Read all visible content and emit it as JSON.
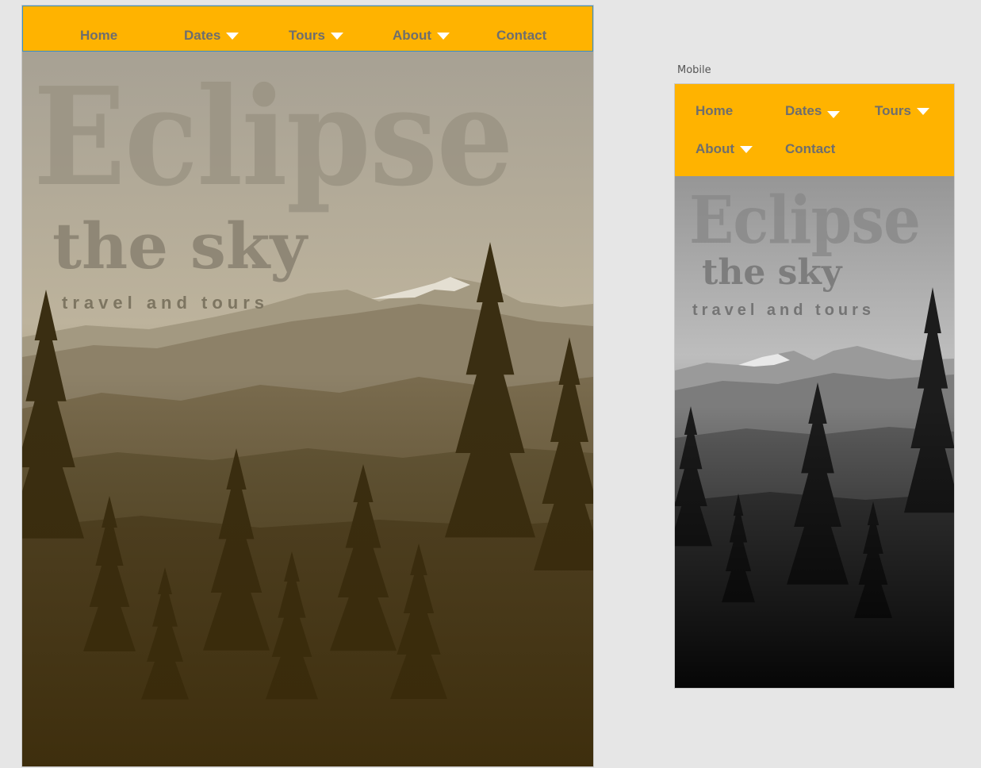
{
  "artboards": {
    "mobile_label": "Mobile"
  },
  "nav": {
    "items": [
      {
        "label": "Home",
        "dropdown": false
      },
      {
        "label": "Dates",
        "dropdown": true
      },
      {
        "label": "Tours",
        "dropdown": true
      },
      {
        "label": "About",
        "dropdown": true
      },
      {
        "label": "Contact",
        "dropdown": false
      }
    ],
    "background": "#FFB300",
    "text_color": "#6E6E6E",
    "caret_color": "#FFFFFF"
  },
  "hero": {
    "title": "Eclipse",
    "subtitle": "the sky",
    "tagline": "travel and tours",
    "desktop_tint": "sepia",
    "mobile_tint": "grayscale"
  }
}
